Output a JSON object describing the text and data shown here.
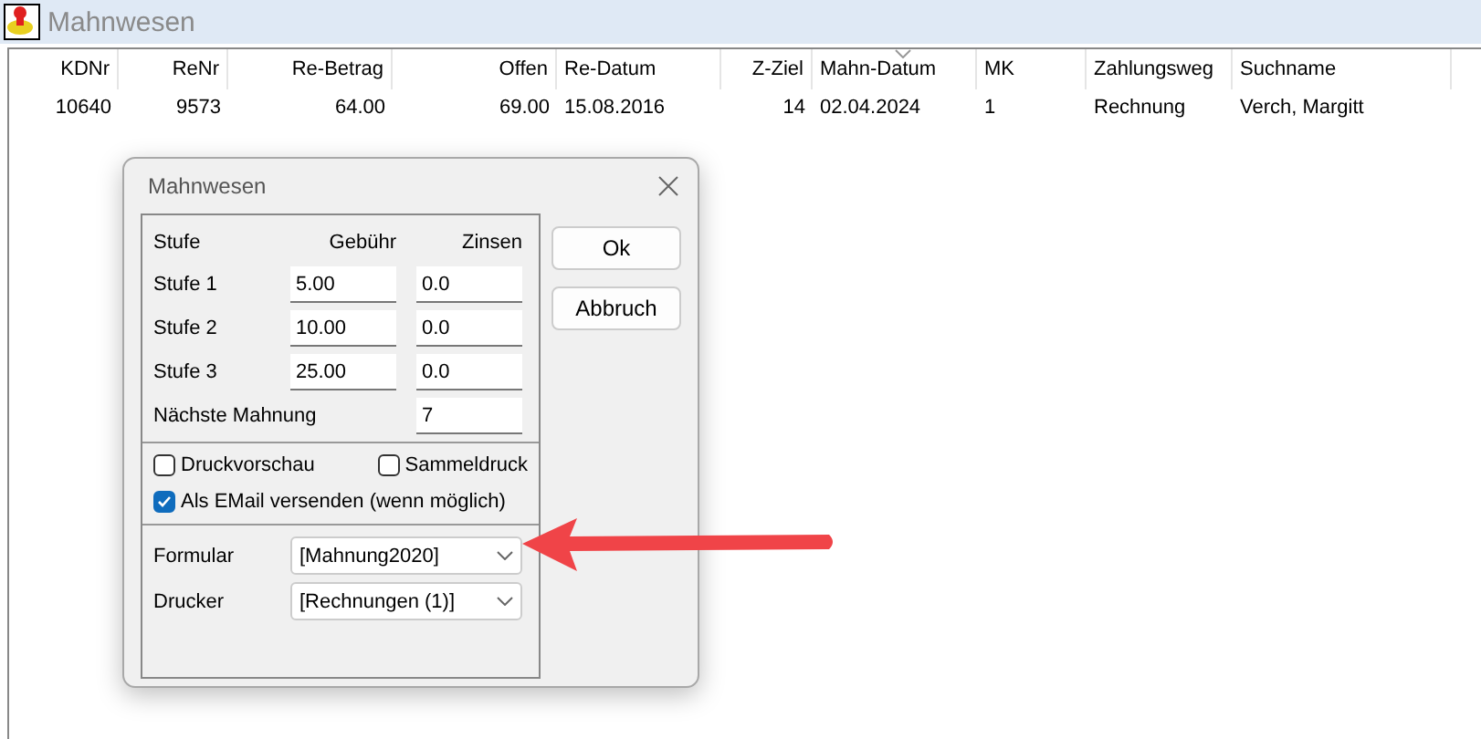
{
  "window": {
    "title": "Mahnwesen"
  },
  "table": {
    "columns": [
      {
        "label": "KDNr",
        "sorted": false
      },
      {
        "label": "ReNr",
        "sorted": false
      },
      {
        "label": "Re-Betrag",
        "sorted": false
      },
      {
        "label": "Offen",
        "sorted": false
      },
      {
        "label": "Re-Datum",
        "sorted": false
      },
      {
        "label": "Z-Ziel",
        "sorted": false
      },
      {
        "label": "Mahn-Datum",
        "sorted": true
      },
      {
        "label": "MK",
        "sorted": false
      },
      {
        "label": "Zahlungsweg",
        "sorted": false
      },
      {
        "label": "Suchname",
        "sorted": false
      }
    ],
    "rows": [
      [
        "10640",
        "9573",
        "64.00",
        "69.00",
        "15.08.2016",
        "14",
        "02.04.2024",
        "1",
        "Rechnung",
        "Verch, Margitt"
      ]
    ]
  },
  "dialog": {
    "title": "Mahnwesen",
    "header": {
      "level": "Stufe",
      "fee": "Gebühr",
      "interest": "Zinsen"
    },
    "levels": [
      {
        "label": "Stufe 1",
        "fee": "5.00",
        "interest": "0.0"
      },
      {
        "label": "Stufe 2",
        "fee": "10.00",
        "interest": "0.0"
      },
      {
        "label": "Stufe 3",
        "fee": "25.00",
        "interest": "0.0"
      }
    ],
    "next_reminder": {
      "label": "Nächste Mahnung",
      "value": "7"
    },
    "option_rows": [
      [
        {
          "label": "Druckvorschau",
          "checked": false
        },
        {
          "label": "Sammeldruck",
          "checked": false
        }
      ],
      [
        {
          "label": "Als EMail versenden (wenn möglich)",
          "checked": true
        }
      ]
    ],
    "selects": [
      {
        "label": "Formular",
        "value": "[Mahnung2020]"
      },
      {
        "label": "Drucker",
        "value": "[Rechnungen (1)]"
      }
    ],
    "buttons": [
      "Ok",
      "Abbruch"
    ]
  }
}
